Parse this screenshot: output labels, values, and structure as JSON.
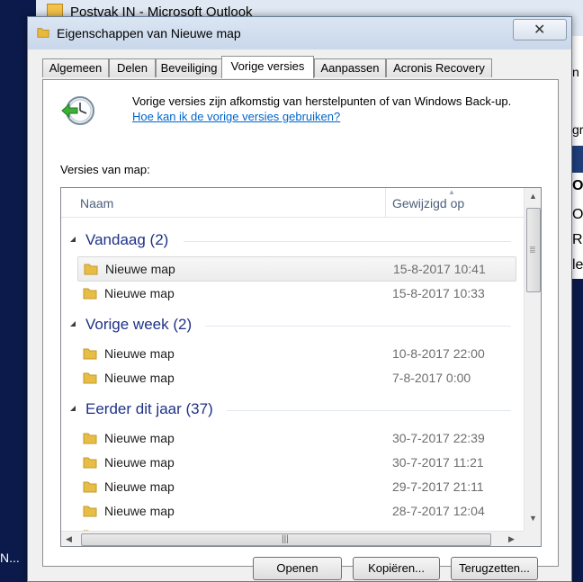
{
  "background": {
    "title": "Postvak IN - Microsoft Outlook",
    "side_letters": [
      "Ov",
      "Re",
      "le",
      "Or",
      "gr",
      "n"
    ],
    "bottom_left": "N..."
  },
  "dialog": {
    "title": "Eigenschappen van Nieuwe map",
    "close_glyph": "✕"
  },
  "tabs": [
    "Algemeen",
    "Delen",
    "Beveiliging",
    "Vorige versies",
    "Aanpassen",
    "Acronis Recovery"
  ],
  "active_tab": "Vorige versies",
  "info": {
    "text": "Vorige versies zijn afkomstig van herstelpunten of van Windows Back-up.",
    "link": "Hoe kan ik de vorige versies gebruiken?"
  },
  "versions_label": "Versies van map:",
  "columns": {
    "name": "Naam",
    "modified": "Gewijzigd op"
  },
  "groups": [
    {
      "title": "Vandaag (2)",
      "items": [
        {
          "name": "Nieuwe map",
          "date": "15-8-2017 10:41",
          "selected": true
        },
        {
          "name": "Nieuwe map",
          "date": "15-8-2017 10:33"
        }
      ]
    },
    {
      "title": "Vorige week (2)",
      "items": [
        {
          "name": "Nieuwe map",
          "date": "10-8-2017 22:00"
        },
        {
          "name": "Nieuwe map",
          "date": "7-8-2017 0:00"
        }
      ]
    },
    {
      "title": "Eerder dit jaar (37)",
      "items": [
        {
          "name": "Nieuwe map",
          "date": "30-7-2017 22:39"
        },
        {
          "name": "Nieuwe map",
          "date": "30-7-2017 11:21"
        },
        {
          "name": "Nieuwe map",
          "date": "29-7-2017 21:11"
        },
        {
          "name": "Nieuwe map",
          "date": "28-7-2017 12:04"
        }
      ]
    }
  ],
  "buttons": {
    "open": "Openen",
    "copy": "Kopiëren...",
    "restore": "Terugzetten..."
  }
}
